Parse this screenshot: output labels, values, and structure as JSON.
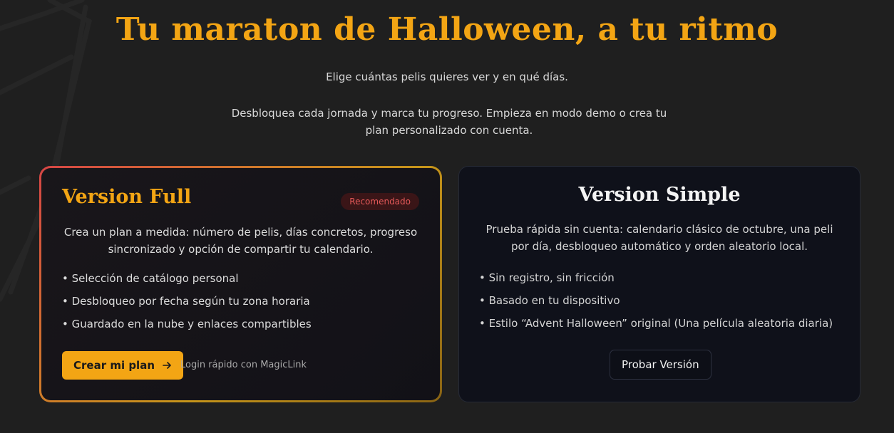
{
  "hero": {
    "title": "Tu maraton de Halloween, a tu ritmo",
    "subtitle": "Elige cuántas pelis quieres ver y en qué días.",
    "description": "Desbloquea cada jornada y marca tu progreso. Empieza en modo demo o crea tu plan personalizado con cuenta."
  },
  "full": {
    "title": "Version Full",
    "badge": "Recomendado",
    "description": "Crea un plan a medida: número de pelis, días concretos, progreso sincronizado y opción de compartir tu calendario.",
    "features": [
      "• Selección de catálogo personal",
      "• Desbloqueo por fecha según tu zona horaria",
      "• Guardado en la nube y enlaces compartibles"
    ],
    "cta_label": "Crear mi plan",
    "cta_icon": "arrow-right-icon",
    "login_label": "Login rápido con MagicLink"
  },
  "simple": {
    "title": "Version Simple",
    "description": "Prueba rápida sin cuenta: calendario clásico de octubre, una peli por día, desbloqueo automático y orden aleatorio local.",
    "features": [
      "• Sin registro, sin fricción",
      "• Basado en tu dispositivo",
      "• Estilo “Advent Halloween” original (Una película aleatoria diaria)"
    ],
    "button_label": "Probar Versión"
  },
  "colors": {
    "accent": "#f3a514",
    "background": "#1f1f1f",
    "badge_text": "#e35858",
    "card_simple_bg": "#0f111a"
  }
}
